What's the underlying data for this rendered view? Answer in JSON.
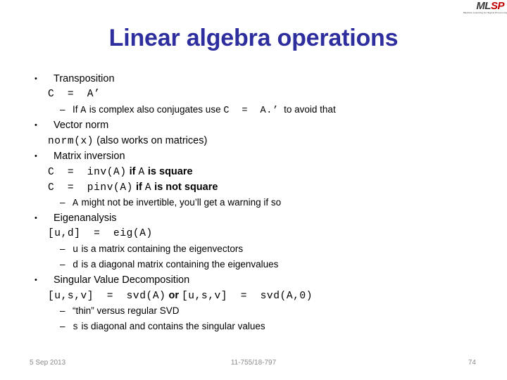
{
  "logo": {
    "primary_text": "ML",
    "accent_text": "SP",
    "tagline": "Machine Learning for Signal Processing",
    "primary_color": "#3b3b3b",
    "accent_color": "#c00000"
  },
  "title": {
    "text": "Linear algebra operations",
    "color": "#2e2e9e"
  },
  "bullet_glyph": "•",
  "dash_glyph": "–",
  "content": [
    {
      "level": 1,
      "text": "Transposition"
    },
    {
      "level": 2,
      "code": "C  =  A’"
    },
    {
      "level": 3,
      "parts": [
        {
          "style": "prose",
          "text": "If "
        },
        {
          "style": "mono",
          "text": "A"
        },
        {
          "style": "prose",
          "text": " is complex also conjugates use "
        },
        {
          "style": "mono",
          "text": "C  =  A.’"
        },
        {
          "style": "prose",
          "text": "  to avoid that"
        }
      ]
    },
    {
      "level": 1,
      "text": "Vector norm"
    },
    {
      "level": 2,
      "parts": [
        {
          "style": "mono",
          "text": "norm(x)"
        },
        {
          "style": "prose-n",
          "text": " (also works on matrices)"
        }
      ]
    },
    {
      "level": 1,
      "text": "Matrix inversion"
    },
    {
      "level": 2,
      "parts": [
        {
          "style": "mono",
          "text": "C  =  inv(A)"
        },
        {
          "style": "prose",
          "text": " if "
        },
        {
          "style": "mono",
          "text": "A"
        },
        {
          "style": "prose",
          "text": " is square"
        }
      ]
    },
    {
      "level": 2,
      "parts": [
        {
          "style": "mono",
          "text": "C  =  pinv(A)"
        },
        {
          "style": "prose",
          "text": " if "
        },
        {
          "style": "mono",
          "text": "A"
        },
        {
          "style": "prose",
          "text": " is not square"
        }
      ]
    },
    {
      "level": 3,
      "parts": [
        {
          "style": "mono",
          "text": "A"
        },
        {
          "style": "prose",
          "text": " might not be invertible, you’ll get a warning if so"
        }
      ]
    },
    {
      "level": 1,
      "text": "Eigenanalysis"
    },
    {
      "level": 2,
      "code": "[u,d]  =  eig(A)"
    },
    {
      "level": 3,
      "parts": [
        {
          "style": "mono",
          "text": "u"
        },
        {
          "style": "prose",
          "text": " is a matrix containing the eigenvectors"
        }
      ]
    },
    {
      "level": 3,
      "parts": [
        {
          "style": "mono",
          "text": "d"
        },
        {
          "style": "prose",
          "text": " is a diagonal matrix containing the eigenvalues"
        }
      ]
    },
    {
      "level": 1,
      "text": "Singular Value Decomposition"
    },
    {
      "level": 2,
      "parts": [
        {
          "style": "mono",
          "text": "[u,s,v]  =  svd(A)"
        },
        {
          "style": "prose",
          "text": " or "
        },
        {
          "style": "mono",
          "text": "[u,s,v]  =  svd(A,0)"
        }
      ]
    },
    {
      "level": 3,
      "parts": [
        {
          "style": "prose",
          "text": "“thin” versus regular SVD"
        }
      ]
    },
    {
      "level": 3,
      "parts": [
        {
          "style": "mono",
          "text": "s"
        },
        {
          "style": "prose",
          "text": " is diagonal and contains the singular values"
        }
      ]
    }
  ],
  "footer": {
    "date": "5 Sep 2013",
    "course": "11-755/18-797",
    "page": "74"
  }
}
